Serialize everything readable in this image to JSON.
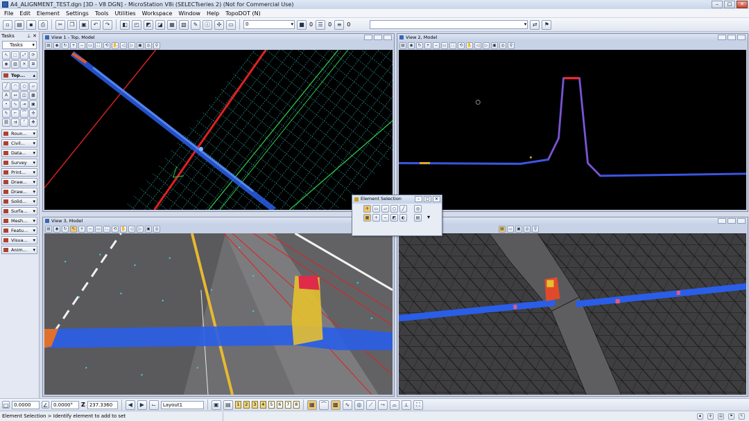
{
  "window": {
    "title": "A4_ALIGNMENT_TEST.dgn [3D - V8 DGN] - MicroStation V8i (SELECTseries 2) (Not for Commercial Use)",
    "minimize": "–",
    "maximize": "□",
    "close": "✕"
  },
  "menu": [
    "File",
    "Edit",
    "Element",
    "Settings",
    "Tools",
    "Utilities",
    "Workspace",
    "Window",
    "Help",
    "TopoDOT (N)"
  ],
  "toolbar": {
    "level_value": "0",
    "color_value": "0",
    "style_value": "0",
    "weight_value": "0",
    "right_value": "0"
  },
  "tasks": {
    "header": "Tasks",
    "pin": "⊥",
    "close": "✕",
    "dropdown": "Tasks",
    "top_item": "Top...",
    "items": [
      "Roun...",
      "Civil...",
      "Data...",
      "Survey",
      "Print...",
      "Draw...",
      "Draw...",
      "Solid...",
      "Surfa...",
      "Mesh...",
      "Featu...",
      "Visua...",
      "Anim..."
    ]
  },
  "views": {
    "view1": "View 1 - Top, Model",
    "view2": "View 2, Model",
    "view3": "View 3, Model",
    "view4": ""
  },
  "element_selection": {
    "title": "Element Selection",
    "close": "✕"
  },
  "bottom": {
    "x_value": "0.0000",
    "angle_value": "0.0000°",
    "z_label": "Z",
    "z_value": "237.3360",
    "layout_value": "Layout1",
    "view_buttons": [
      "1",
      "2",
      "3",
      "4",
      "5",
      "6",
      "7",
      "8"
    ]
  },
  "status": {
    "message": "Element Selection > Identify element to add to set"
  },
  "colors": {
    "viewport_bg": "#000000",
    "grid_cyan": "#3fd0d0",
    "red_line": "#e02020",
    "green_line": "#2ec44a",
    "scan_blue": "#2a5ee8"
  }
}
